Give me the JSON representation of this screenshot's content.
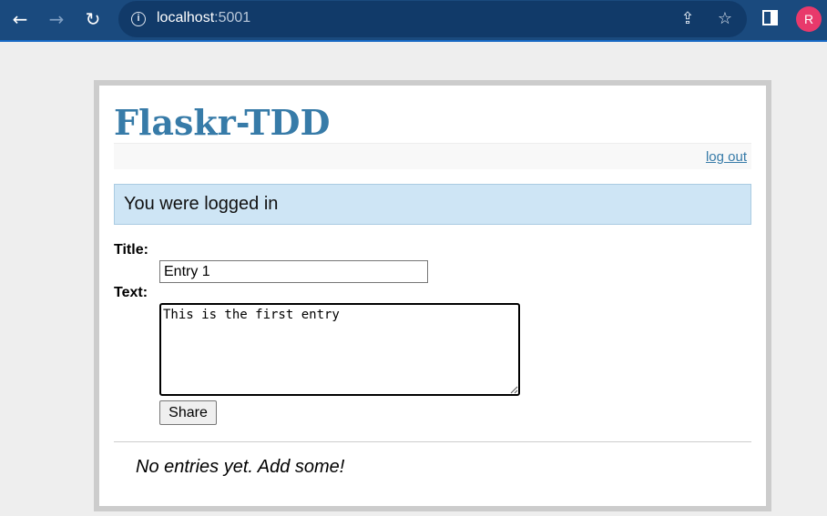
{
  "browser": {
    "back_icon": "arrow-left-icon",
    "forward_icon": "arrow-right-icon",
    "reload_icon": "reload-icon",
    "url_host": "localhost",
    "url_port": ":5001",
    "profile_initial": "R",
    "profile_color": "#e8396b",
    "chrome_color": "#1a4a7e"
  },
  "page": {
    "title": "Flaskr-TDD",
    "logout_label": "log out",
    "flash_message": "You were logged in",
    "form": {
      "title_label": "Title:",
      "title_value": "Entry 1",
      "text_label": "Text:",
      "text_value": "This is the first entry",
      "share_label": "Share"
    },
    "no_entries_text": "No entries yet. Add some!",
    "accent_color": "#377ba8"
  }
}
